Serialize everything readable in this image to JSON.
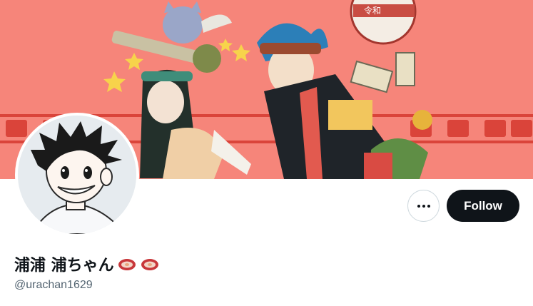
{
  "profile": {
    "display_name": "浦浦 浦ちゃん",
    "name_emojis": [
      "meat-icon",
      "meat-icon"
    ],
    "handle": "@urachan1629"
  },
  "actions": {
    "more_icon": "more-horizontal-icon",
    "follow_label": "Follow"
  },
  "banner": {
    "sign_text": "令和",
    "background_color": "#f6857a"
  },
  "colors": {
    "follow_bg": "#0f1419",
    "follow_text": "#ffffff",
    "handle_text": "#536471"
  }
}
